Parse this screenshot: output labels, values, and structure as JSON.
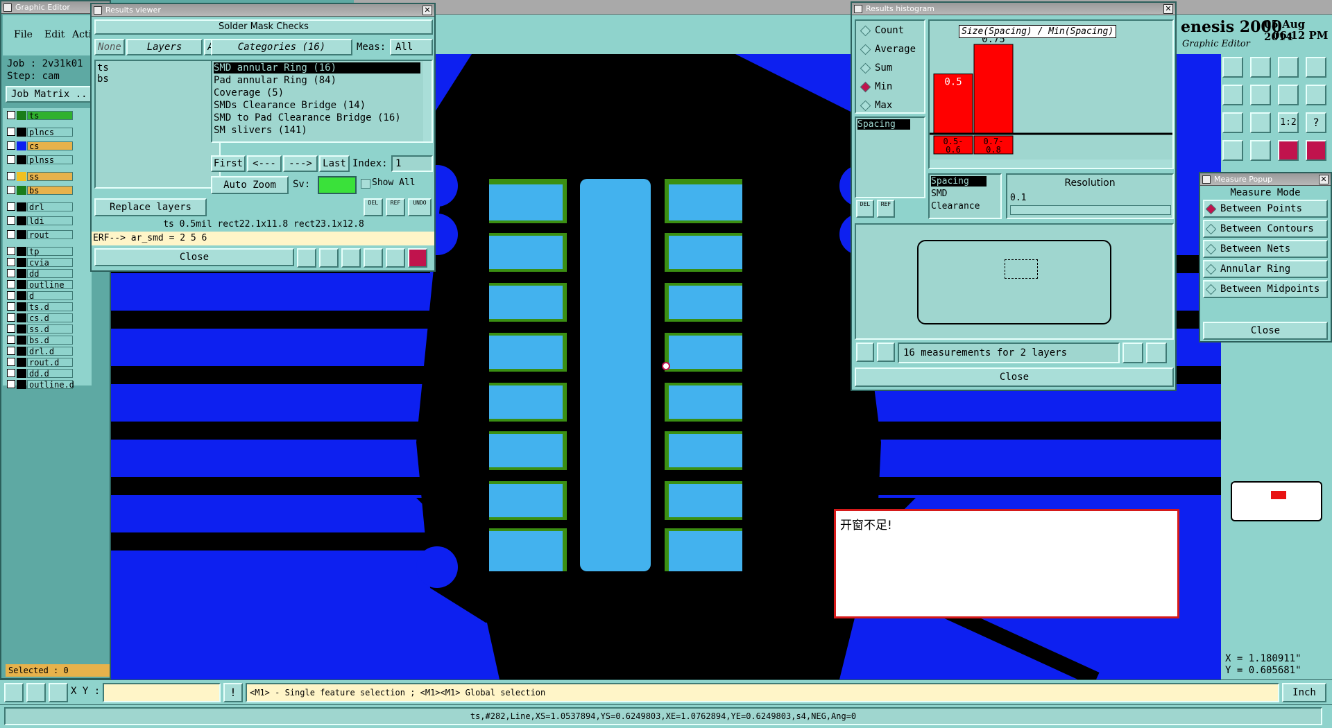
{
  "topbar": {
    "title_fragment": "enesis 2000",
    "subtitle": "Graphic Editor",
    "date": "05 Aug 2014",
    "time": "06:12 PM"
  },
  "graphic_editor": {
    "title": "Graphic Editor",
    "menu": [
      "File",
      "Edit",
      "Acti"
    ],
    "job": "Job : 2v31k01",
    "step": "Step: cam",
    "job_matrix": "Job Matrix ..",
    "layers": [
      "ts",
      "plncs",
      "cs",
      "plnss",
      "ss",
      "bs",
      "drl",
      "ldi",
      "rout",
      "tp",
      "cvia",
      "dd",
      "outline",
      "d",
      "ts.d",
      "cs.d",
      "ss.d",
      "bs.d",
      "drl.d",
      "rout.d",
      "dd.d",
      "outline.d"
    ],
    "selected": "Selected : 0"
  },
  "results_viewer": {
    "title": "Results viewer",
    "header": "Solder Mask Checks",
    "none_btn": "None",
    "layers_btn": "Layers",
    "all_btn": "All",
    "categories_btn": "Categories (16)",
    "meas_label": "Meas:",
    "meas_value": "All",
    "layer_list": [
      "ts",
      "bs"
    ],
    "categories": [
      "SMD annular Ring (16)",
      "Pad annular Ring (84)",
      "Coverage (5)",
      "SMDs Clearance Bridge (14)",
      "SMD to Pad Clearance Bridge (16)",
      "SM slivers (141)"
    ],
    "nav": {
      "first": "First",
      "prev": "<---",
      "next": "--->",
      "last": "Last",
      "index_label": "Index:",
      "index_value": "1"
    },
    "auto_zoom": "Auto Zoom",
    "sv_label": "Sv:",
    "show_all": "Show All",
    "replace_layers": "Replace layers",
    "icon_del": "DEL",
    "icon_ref": "REF",
    "icon_undo": "UNDO",
    "info": "ts 0.5mil  rect22.1x11.8  rect23.1x12.8",
    "erf": "ERF--> ar_smd = 2 5 6",
    "close": "Close"
  },
  "histogram": {
    "title": "Results histogram",
    "options": [
      "Count",
      "Average",
      "Sum",
      "Min",
      "Max"
    ],
    "selected_option": "Min",
    "chart_title": "Size(Spacing) / Min(Spacing)",
    "bars": [
      {
        "label": "0.5",
        "bin": "0.5-\n0.6",
        "value": 0.5
      },
      {
        "label": "0.75",
        "bin": "0.7-\n0.8",
        "value": 0.75
      }
    ],
    "left_list": [
      "Spacing"
    ],
    "types": [
      "Spacing",
      "SMD",
      "Clearance"
    ],
    "resolution_label": "Resolution",
    "resolution_value": "0.1",
    "icon_del": "DEL",
    "icon_ref": "REF",
    "measurements": "16 measurements for 2 layers",
    "close": "Close"
  },
  "measure_popup": {
    "title": "Measure Popup",
    "header": "Measure Mode",
    "modes": [
      "Between Points",
      "Between Contours",
      "Between Nets",
      "Annular Ring",
      "Between Midpoints"
    ],
    "selected_mode": "Between Points",
    "close": "Close"
  },
  "note": {
    "text": "开窗不足!"
  },
  "coords": {
    "x": "X = 1.180911\"",
    "y": "Y = 0.605681\""
  },
  "bottom": {
    "xy_label": "X Y :",
    "hint": "<M1> - Single feature selection ; <M1><M1> Global selection",
    "units": "Inch",
    "status": "ts,#282,Line,XS=1.0537894,YS=0.6249803,XE=1.0762894,YE=0.6249803,s4,NEG,Ang=0"
  },
  "colors": {
    "board": "#0d20f0",
    "pad": "#43b2ee",
    "mask": "#3b8f13",
    "panel": "#8fd3cc",
    "histbar": "#ff0000"
  }
}
